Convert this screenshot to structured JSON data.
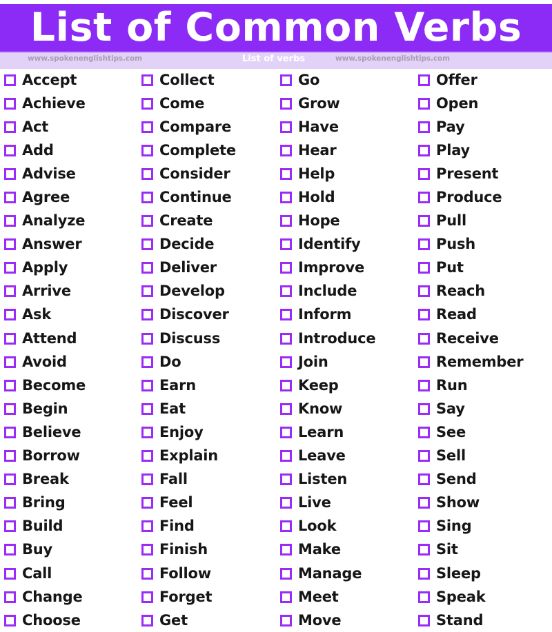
{
  "header": {
    "title": "List of Common Verbs",
    "banner_color": "#8B2BF5",
    "title_color": "#FFFFFF"
  },
  "subheader": {
    "watermark_left": "www.spokenenglishtips.com",
    "center_label": "List of verbs",
    "watermark_right": "www.spokenenglishtips.com",
    "background_color": "#E3D2F7",
    "watermark_color": "#A99BB6",
    "center_label_color": "#FFFFFF"
  },
  "checklist": {
    "checkbox_border_color": "#9B2BF7",
    "checkbox_shadow_color": "#D9A8FB",
    "text_color": "#161616",
    "columns": [
      {
        "index": 1,
        "items": [
          "Accept",
          "Achieve",
          "Act",
          "Add",
          "Advise",
          "Agree",
          "Analyze",
          "Answer",
          "Apply",
          "Arrive",
          "Ask",
          "Attend",
          "Avoid",
          "Become",
          "Begin",
          "Believe",
          "Borrow",
          "Break",
          "Bring",
          "Build",
          "Buy",
          "Call",
          "Change",
          "Choose"
        ]
      },
      {
        "index": 2,
        "items": [
          "Collect",
          "Come",
          "Compare",
          "Complete",
          "Consider",
          "Continue",
          "Create",
          "Decide",
          "Deliver",
          "Develop",
          "Discover",
          "Discuss",
          "Do",
          "Earn",
          "Eat",
          "Enjoy",
          "Explain",
          "Fall",
          "Feel",
          "Find",
          "Finish",
          "Follow",
          "Forget",
          "Get"
        ]
      },
      {
        "index": 3,
        "items": [
          "Go",
          "Grow",
          "Have",
          "Hear",
          "Help",
          "Hold",
          "Hope",
          "Identify",
          "Improve",
          "Include",
          "Inform",
          "Introduce",
          "Join",
          "Keep",
          "Know",
          "Learn",
          "Leave",
          "Listen",
          "Live",
          "Look",
          "Make",
          "Manage",
          "Meet",
          "Move"
        ]
      },
      {
        "index": 4,
        "items": [
          "Offer",
          "Open",
          "Pay",
          "Play",
          "Present",
          "Produce",
          "Pull",
          "Push",
          "Put",
          "Reach",
          "Read",
          "Receive",
          "Remember",
          "Run",
          "Say",
          "See",
          "Sell",
          "Send",
          "Show",
          "Sing",
          "Sit",
          "Sleep",
          "Speak",
          "Stand"
        ]
      }
    ]
  }
}
